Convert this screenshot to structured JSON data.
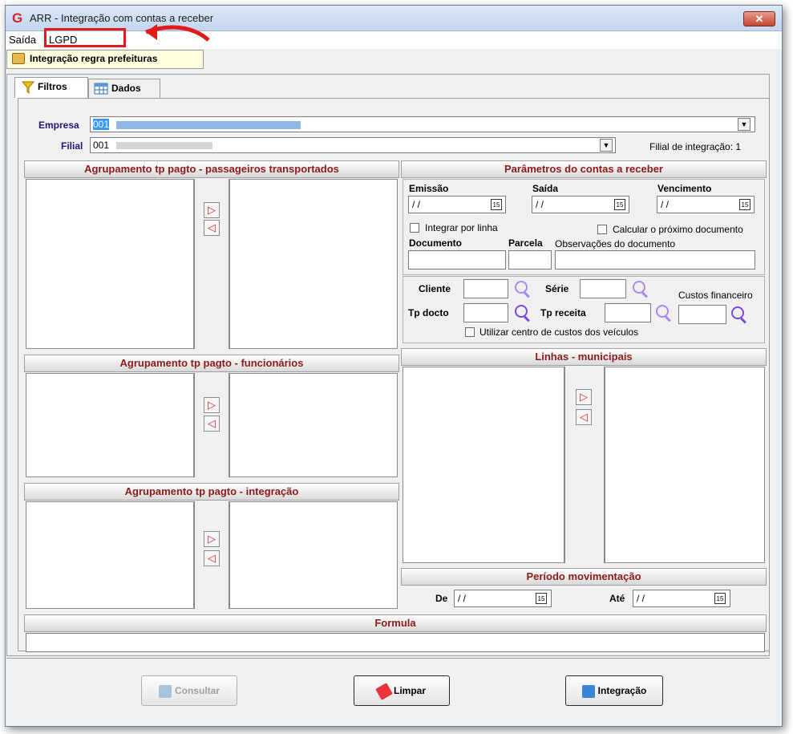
{
  "window": {
    "title": "ARR - Integração com contas a receber",
    "app_icon": "G",
    "close_label": "✕"
  },
  "menu": {
    "items": [
      "Saída",
      "LGPD"
    ]
  },
  "toolbar": {
    "button_label": "Integração regra prefeituras"
  },
  "tabs": [
    {
      "label": "Filtros"
    },
    {
      "label": "Dados"
    }
  ],
  "empresa": {
    "label": "Empresa",
    "value": "001"
  },
  "filial": {
    "label": "Filial",
    "value": "001",
    "note": "Filial de integração: 1"
  },
  "sections": {
    "passageiros": "Agrupamento tp pagto - passageiros transportados",
    "funcionarios": "Agrupamento tp pagto - funcionários",
    "integracao": "Agrupamento tp pagto - integração",
    "parametros": "Parâmetros do contas a receber",
    "linhas": "Linhas - municipais",
    "periodo": "Período movimentação",
    "formula": "Formula"
  },
  "params": {
    "emissao_label": "Emissão",
    "emissao_value": " / /",
    "saida_label": "Saída",
    "saida_value": " / /",
    "vencimento_label": "Vencimento",
    "vencimento_value": " / /",
    "integrar_label": "Integrar por linha",
    "calcular_label": "Calcular o próximo documento",
    "documento_label": "Documento",
    "parcela_label": "Parcela",
    "obs_label": "Observações do documento",
    "cliente_label": "Cliente",
    "serie_label": "Série",
    "custos_label": "Custos financeiro",
    "tpdocto_label": "Tp docto",
    "tpreceita_label": "Tp receita",
    "utilizar_label": "Utilizar centro de custos dos veículos"
  },
  "periodo": {
    "de_label": "De",
    "de_value": " / /",
    "ate_label": "Até",
    "ate_value": " / /"
  },
  "calendar_glyph": "15",
  "arrows": {
    "right": "▷",
    "left": "◁"
  },
  "buttons": {
    "consultar": "Consultar",
    "limpar": "Limpar",
    "integracao": "Integração"
  },
  "colors": {
    "section_title": "#8b1a1a",
    "highlight": "#e21a1a",
    "selection": "#3399ff"
  }
}
